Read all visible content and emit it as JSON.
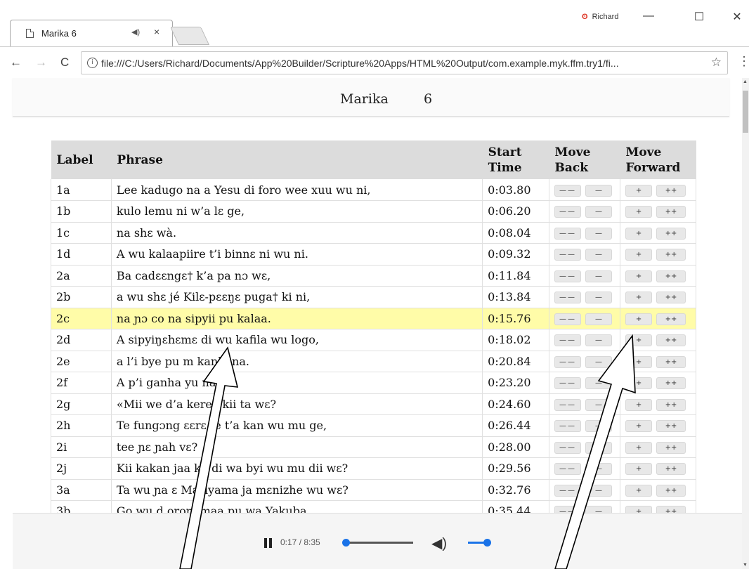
{
  "browser": {
    "tab_title": "Marika 6",
    "tab_audio_icon": "◀)",
    "tab_close": "×",
    "profile_name": "Richard",
    "url": "file:///C:/Users/Richard/Documents/App%20Builder/Scripture%20Apps/HTML%20Output/com.example.myk.ffm.try1/fi...",
    "minimize": "—",
    "maximize": "☐",
    "close": "✕",
    "back": "←",
    "forward": "→",
    "reload": "C",
    "star": "☆",
    "menu": "⋮"
  },
  "header": {
    "book": "Marika",
    "chapter": "6"
  },
  "table": {
    "headers": {
      "label": "Label",
      "phrase": "Phrase",
      "start_time_1": "Start",
      "start_time_2": "Time",
      "move_back_1": "Move",
      "move_back_2": "Back",
      "move_forward_1": "Move",
      "move_forward_2": "Forward"
    },
    "buttons": {
      "back_big": "——",
      "back_small": "—",
      "forward_small": "+",
      "forward_big": "++"
    },
    "highlighted_index": 6,
    "rows": [
      {
        "label": "1a",
        "phrase": "Lee kadugo na a Yesu di foro wee xuu wu ni,",
        "time": "0:03.80"
      },
      {
        "label": "1b",
        "phrase": "kulo lemu ni w’a lɛ ge,",
        "time": "0:06.20"
      },
      {
        "label": "1c",
        "phrase": "na shɛ wà.",
        "time": "0:08.04"
      },
      {
        "label": "1d",
        "phrase": "A wu kalaapiire t’i binnɛ ni wu ni.",
        "time": "0:09.32"
      },
      {
        "label": "2a",
        "phrase": "Ba cadɛɛngɛ† k’a pa nɔ wɛ,",
        "time": "0:11.84"
      },
      {
        "label": "2b",
        "phrase": "a wu shɛ jé Kilɛ-pɛɛŋɛ puga† ki ni,",
        "time": "0:13.84"
      },
      {
        "label": "2c",
        "phrase": "na ɲɔ co na sipyii pu kalaa.",
        "time": "0:15.76"
      },
      {
        "label": "2d",
        "phrase": "A sipyiŋɛhɛmɛ  di wu kafila wu logo,",
        "time": "0:18.02"
      },
      {
        "label": "2e",
        "phrase": "a l’i bye pu m   kanhana.",
        "time": "0:20.84"
      },
      {
        "label": "2f",
        "phrase": "A p’i ganha    yu na:",
        "time": "0:23.20"
      },
      {
        "label": "2g",
        "phrase": "«Mii we d’a    keree kii ta wɛ?",
        "time": "0:24.60"
      },
      {
        "label": "2h",
        "phrase": "Te fungɔng    ɛɛrɛ te t’a kan wu mu ge,",
        "time": "0:26.44"
      },
      {
        "label": "2i",
        "phrase": "tee ɲɛ ɲah    vɛ?",
        "time": "0:28.00"
      },
      {
        "label": "2j",
        "phrase": "Kii kakan    jaa kii di wa byi wu mu dii wɛ?",
        "time": "0:29.56"
      },
      {
        "label": "3a",
        "phrase": "Ta wu ɲa    ɛ Mariyama ja mɛnizhe wu wɛ?",
        "time": "0:32.76"
      },
      {
        "label": "3b",
        "phrase": "Go wu d    oronamaa pu wa Yakuba",
        "time": "0:35.44"
      }
    ]
  },
  "player": {
    "time": "0:17 / 8:35",
    "progress": 0.033,
    "volume": 1.0
  }
}
